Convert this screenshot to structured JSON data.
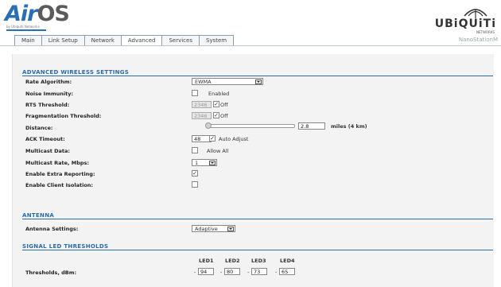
{
  "header": {
    "logo_main": "Air",
    "logo_os": "OS",
    "logo_tagline": "by Ubiquiti Networks",
    "brand": "UBiQUiTi",
    "brand_sub": "NETWORKS",
    "device_name": "NanoStationM"
  },
  "tabs": [
    {
      "label": "Main"
    },
    {
      "label": "Link Setup"
    },
    {
      "label": "Network"
    },
    {
      "label": "Advanced"
    },
    {
      "label": "Services"
    },
    {
      "label": "System"
    }
  ],
  "advanced_wireless": {
    "title": "ADVANCED WIRELESS SETTINGS",
    "rate_algorithm": {
      "label": "Rate Algorithm:",
      "value": "EWMA"
    },
    "noise_immunity": {
      "label": "Noise Immunity:",
      "option": "Enabled",
      "checked": false
    },
    "rts_threshold": {
      "label": "RTS Threshold:",
      "value": "2346",
      "off_label": "Off",
      "off_checked": true
    },
    "fragmentation_threshold": {
      "label": "Fragmentation Threshold:",
      "value": "2346",
      "off_label": "Off",
      "off_checked": true
    },
    "distance": {
      "label": "Distance:",
      "value": "2.8",
      "unit": "miles (4 km)",
      "slider_fraction": 0.0
    },
    "ack_timeout": {
      "label": "ACK Timeout:",
      "value": "48",
      "auto_label": "Auto Adjust",
      "auto_checked": true
    },
    "multicast_data": {
      "label": "Multicast Data:",
      "option": "Allow All",
      "checked": false
    },
    "multicast_rate": {
      "label": "Multicast Rate, Mbps:",
      "value": "1"
    },
    "extra_reporting": {
      "label": "Enable Extra Reporting:",
      "checked": true
    },
    "client_isolation": {
      "label": "Enable Client Isolation:",
      "checked": false
    }
  },
  "antenna": {
    "title": "ANTENNA",
    "settings": {
      "label": "Antenna Settings:",
      "value": "Adaptive"
    }
  },
  "signal_led": {
    "title": "SIGNAL LED THRESHOLDS",
    "label": "Thresholds, dBm:",
    "leds": [
      {
        "name": "LED1",
        "value": "94"
      },
      {
        "name": "LED2",
        "value": "80"
      },
      {
        "name": "LED3",
        "value": "73"
      },
      {
        "name": "LED4",
        "value": "65"
      }
    ],
    "prefix": "-"
  },
  "colors": {
    "accent": "#2b6ba8",
    "logo": "#2a6fb4"
  },
  "check_glyph": "✓"
}
